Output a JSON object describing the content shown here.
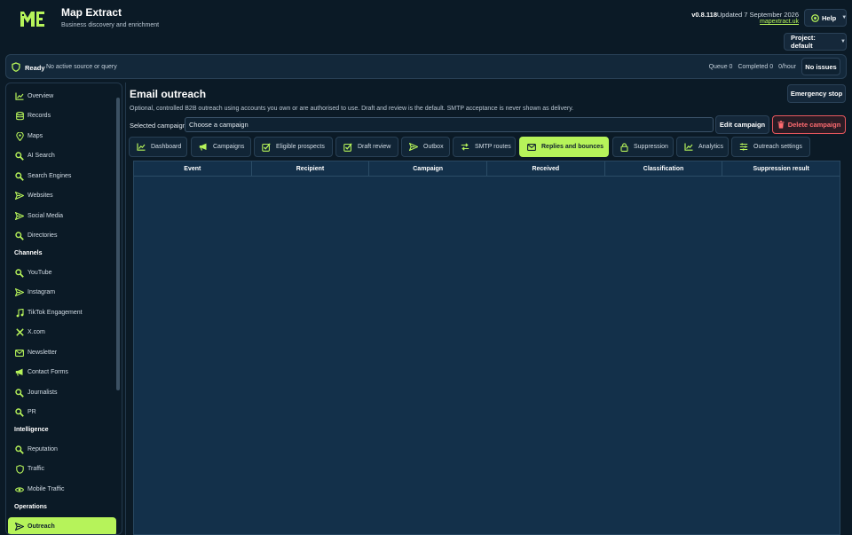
{
  "app": {
    "title": "Map Extract",
    "subtitle": "Business discovery and enrichment",
    "version": "v0.8.118",
    "updated": "Updated 7 September 2026",
    "site_link": "mapextract.uk",
    "help_label": "Help",
    "project_label": "Project: default",
    "accent_color": "#b6f35a"
  },
  "status": {
    "state": "Ready",
    "message": "No active source or query",
    "queue": "Queue 0",
    "completed": "Completed 0",
    "rate": "0/hour",
    "issues_label": "No issues"
  },
  "sidebar": {
    "items": [
      {
        "label": "Overview",
        "icon": "chart-line-icon"
      },
      {
        "label": "Records",
        "icon": "database-icon"
      },
      {
        "label": "Maps",
        "icon": "map-pin-icon"
      },
      {
        "label": "AI Search",
        "icon": "search-icon"
      },
      {
        "label": "Search Engines",
        "icon": "search-icon"
      },
      {
        "label": "Websites",
        "icon": "send-icon"
      },
      {
        "label": "Social Media",
        "icon": "send-icon"
      },
      {
        "label": "Directories",
        "icon": "search-icon"
      }
    ],
    "channels_heading": "Channels",
    "channels": [
      {
        "label": "YouTube",
        "icon": "search-icon"
      },
      {
        "label": "Instagram",
        "icon": "send-icon"
      },
      {
        "label": "TikTok Engagement",
        "icon": "music-icon"
      },
      {
        "label": "X.com",
        "icon": "x-icon"
      },
      {
        "label": "Newsletter",
        "icon": "mail-icon"
      },
      {
        "label": "Contact Forms",
        "icon": "megaphone-icon"
      },
      {
        "label": "Journalists",
        "icon": "search-icon"
      },
      {
        "label": "PR",
        "icon": "search-icon"
      }
    ],
    "intelligence_heading": "Intelligence",
    "intelligence": [
      {
        "label": "Reputation",
        "icon": "search-icon"
      },
      {
        "label": "Traffic",
        "icon": "shield-icon"
      },
      {
        "label": "Mobile Traffic",
        "icon": "eye-icon"
      }
    ],
    "operations_heading": "Operations",
    "operations": [
      {
        "label": "Outreach",
        "icon": "send-icon"
      }
    ]
  },
  "main": {
    "title": "Email outreach",
    "description": "Optional, controlled B2B outreach using accounts you own or are authorised to use. Draft and review is the default. SMTP acceptance is never shown as delivery.",
    "emergency_stop_label": "Emergency stop",
    "campaign_label": "Selected campaign",
    "campaign_value": "Choose a campaign",
    "edit_label": "Edit campaign",
    "delete_label": "Delete campaign",
    "tabs": [
      {
        "label": "Dashboard",
        "icon": "chart-line-icon"
      },
      {
        "label": "Campaigns",
        "icon": "megaphone-icon"
      },
      {
        "label": "Eligible prospects",
        "icon": "check-square-icon"
      },
      {
        "label": "Draft review",
        "icon": "check-square-icon"
      },
      {
        "label": "Outbox",
        "icon": "send-icon"
      },
      {
        "label": "SMTP routes",
        "icon": "route-icon"
      },
      {
        "label": "Replies and bounces",
        "icon": "mail-icon"
      },
      {
        "label": "Suppression",
        "icon": "lock-icon"
      },
      {
        "label": "Analytics",
        "icon": "chart-line-icon"
      },
      {
        "label": "Outreach settings",
        "icon": "sliders-icon"
      }
    ],
    "active_tab": "Replies and bounces",
    "table": {
      "columns": [
        "Event",
        "Recipient",
        "Campaign",
        "Received",
        "Classification",
        "Suppression result"
      ],
      "rows": []
    }
  }
}
